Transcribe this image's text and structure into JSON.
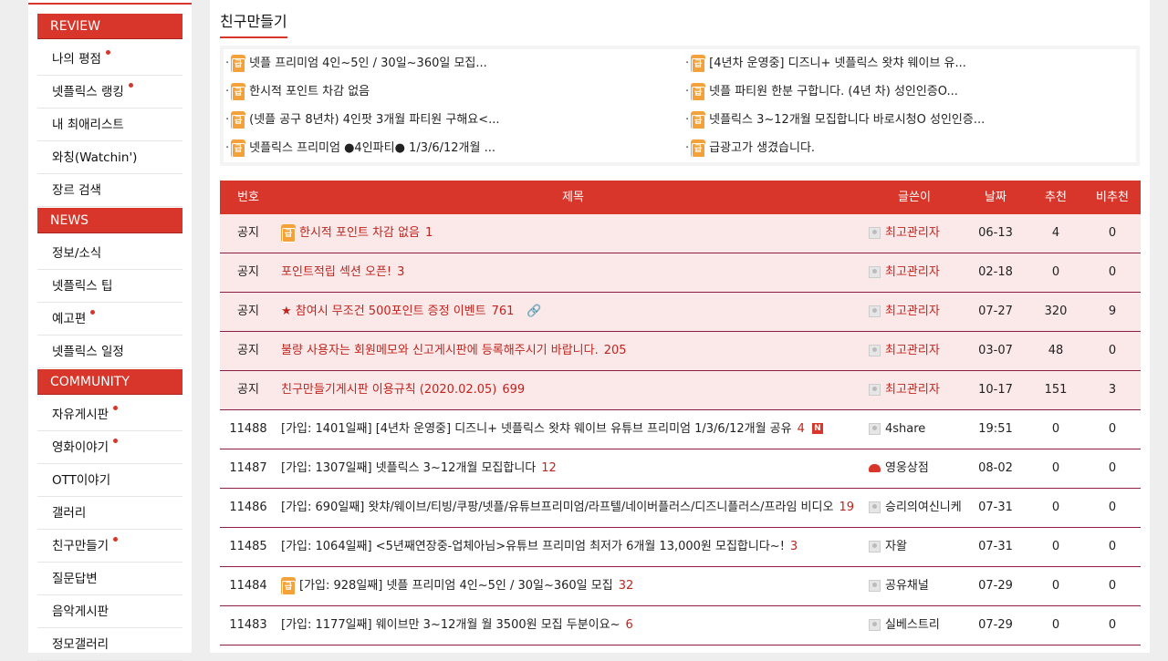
{
  "sidebar": {
    "sections": [
      {
        "label": "REVIEW",
        "items": [
          {
            "label": "나의 평점",
            "dot": true
          },
          {
            "label": "넷플릭스 랭킹",
            "dot": true
          },
          {
            "label": "내 최애리스트",
            "dot": false
          },
          {
            "label": "와칭(Watchin')",
            "dot": false
          },
          {
            "label": "장르 검색",
            "dot": false
          }
        ]
      },
      {
        "label": "NEWS",
        "items": [
          {
            "label": "정보/소식",
            "dot": false
          },
          {
            "label": "넷플릭스 팁",
            "dot": false
          },
          {
            "label": "예고편",
            "dot": true
          },
          {
            "label": "넷플릭스 일정",
            "dot": false
          }
        ]
      },
      {
        "label": "COMMUNITY",
        "items": [
          {
            "label": "자유게시판",
            "dot": true
          },
          {
            "label": "영화이야기",
            "dot": true
          },
          {
            "label": "OTT이야기",
            "dot": false
          },
          {
            "label": "갤러리",
            "dot": false
          },
          {
            "label": "친구만들기",
            "dot": true
          },
          {
            "label": "질문답변",
            "dot": false
          },
          {
            "label": "음악게시판",
            "dot": false
          },
          {
            "label": "정모갤러리",
            "dot": false
          }
        ]
      }
    ]
  },
  "board": {
    "title": "친구만들기",
    "badge_label": "급",
    "featured": [
      "넷플 프리미엄 4인~5인 / 30일~360일 모집...",
      "[4년차 운영중] 디즈니+ 넷플릭스 왓챠 웨이브 유...",
      "한시적 포인트 차감 없음",
      "넷플 파티원 한분 구합니다. (4년 차) 성인인증O...",
      "(넷플 공구 8년차) 4인팟 3개월 파티원 구해요<...",
      "넷플릭스 3~12개월 모집합니다 바로시청O 성인인증...",
      "넷플릭스 프리미엄 ●4인파티● 1/3/6/12개월 ...",
      "급광고가 생겼습니다."
    ],
    "columns": [
      "번호",
      "제목",
      "글쓴이",
      "날짜",
      "추천",
      "비추천"
    ],
    "rows": [
      {
        "num": "공지",
        "badge": true,
        "title": "한시적 포인트 차감 없음",
        "comments": "1",
        "author": "최고관리자",
        "date": "06-13",
        "rec": "4",
        "unrec": "0",
        "notice": true
      },
      {
        "num": "공지",
        "badge": false,
        "title": "포인트적립 섹션 오픈!",
        "comments": "3",
        "author": "최고관리자",
        "date": "02-18",
        "rec": "0",
        "unrec": "0",
        "notice": true
      },
      {
        "num": "공지",
        "badge": false,
        "title": "★ 참여시 무조건 500포인트 증정 이벤트",
        "comments": "761",
        "author": "최고관리자",
        "date": "07-27",
        "rec": "320",
        "unrec": "9",
        "notice": true,
        "link": true
      },
      {
        "num": "공지",
        "badge": false,
        "title": "불량 사용자는 회원메모와 신고게시판에 등록해주시기 바랍니다.",
        "comments": "205",
        "author": "최고관리자",
        "date": "03-07",
        "rec": "48",
        "unrec": "0",
        "notice": true
      },
      {
        "num": "공지",
        "badge": false,
        "title": "친구만들기게시판 이용규칙 (2020.02.05)",
        "comments": "699",
        "author": "최고관리자",
        "date": "10-17",
        "rec": "151",
        "unrec": "3",
        "notice": true
      },
      {
        "num": "11488",
        "badge": false,
        "title": "[가입: 1401일째] [4년차 운영중] 디즈니+ 넷플릭스 왓챠 웨이브 유튜브 프리미엄 1/3/6/12개월 공유",
        "comments": "4",
        "author": "4share",
        "date": "19:51",
        "rec": "0",
        "unrec": "0",
        "notice": false,
        "new": "N"
      },
      {
        "num": "11487",
        "badge": false,
        "title": "[가입: 1307일째] 넷플릭스 3~12개월 모집합니다",
        "comments": "12",
        "author": "영웅상점",
        "date": "08-02",
        "rec": "0",
        "unrec": "0",
        "notice": false,
        "red_icon": true
      },
      {
        "num": "11486",
        "badge": false,
        "title": "[가입: 690일째] 왓챠/웨이브/티빙/쿠팡/넷플/유튜브프리미엄/라프텔/네이버플러스/디즈니플러스/프라임 비디오",
        "comments": "19",
        "author": "승리의여신니케",
        "date": "07-31",
        "rec": "0",
        "unrec": "0",
        "notice": false
      },
      {
        "num": "11485",
        "badge": false,
        "title": "[가입: 1064일째] <5년째연장중-업체아님>유튜브 프리미엄 최저가 6개월 13,000원 모집합니다~!",
        "comments": "3",
        "author": "자왈",
        "date": "07-31",
        "rec": "0",
        "unrec": "0",
        "notice": false
      },
      {
        "num": "11484",
        "badge": true,
        "title": "[가입: 928일째] 넷플 프리미엄 4인~5인 / 30일~360일 모집",
        "comments": "32",
        "author": "공유채널",
        "date": "07-29",
        "rec": "0",
        "unrec": "0",
        "notice": false
      },
      {
        "num": "11483",
        "badge": false,
        "title": "[가입: 1177일째] 웨이브만 3~12개월 월 3500원 모집 두분이요~",
        "comments": "6",
        "author": "실베스트리",
        "date": "07-29",
        "rec": "0",
        "unrec": "0",
        "notice": false
      }
    ]
  },
  "colors": {
    "accent": "#d8362a",
    "notice_bg": "#fbe8e8",
    "badge": "#f3a23b",
    "divider": "#8b1d47"
  }
}
